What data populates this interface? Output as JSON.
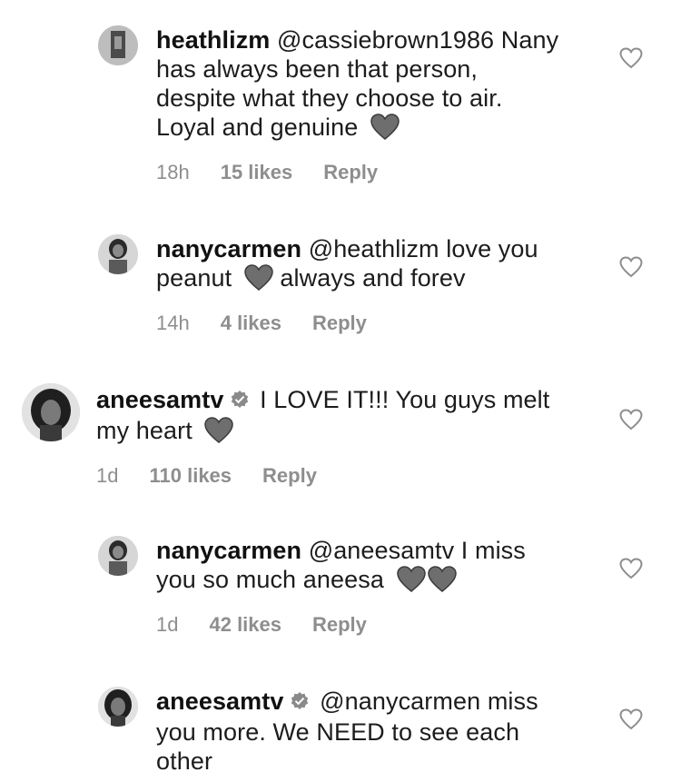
{
  "comments": [
    {
      "username": "heathlizm",
      "verified": false,
      "mention": "@cassiebrown1986",
      "lines": [
        "Nany",
        "has always been that person,",
        "despite what they choose to air.",
        "Loyal and genuine"
      ],
      "time": "18h",
      "likes": "15 likes",
      "reply": "Reply"
    },
    {
      "username": "nanycarmen",
      "verified": false,
      "mention": "@heathlizm",
      "lines": [
        "love you",
        "peanut",
        "always and forev"
      ],
      "time": "14h",
      "likes": "4 likes",
      "reply": "Reply"
    },
    {
      "username": "aneesamtv",
      "verified": true,
      "lines": [
        "I LOVE IT!!! You guys melt",
        "my heart"
      ],
      "time": "1d",
      "likes": "110 likes",
      "reply": "Reply"
    },
    {
      "username": "nanycarmen",
      "verified": false,
      "mention": "@aneesamtv",
      "lines": [
        "I miss",
        "you so much aneesa"
      ],
      "time": "1d",
      "likes": "42 likes",
      "reply": "Reply"
    },
    {
      "username": "aneesamtv",
      "verified": true,
      "mention": "@nanycarmen",
      "lines": [
        "miss",
        "you more. We NEED to see each",
        "other"
      ]
    }
  ],
  "icons": {
    "heart_emoji": "grey-heart-emoji",
    "like": "heart-outline-icon",
    "verified": "verified-badge-icon"
  },
  "colors": {
    "meta_text": "#8e8e8e",
    "emoji_heart": "#6e6e6e"
  }
}
